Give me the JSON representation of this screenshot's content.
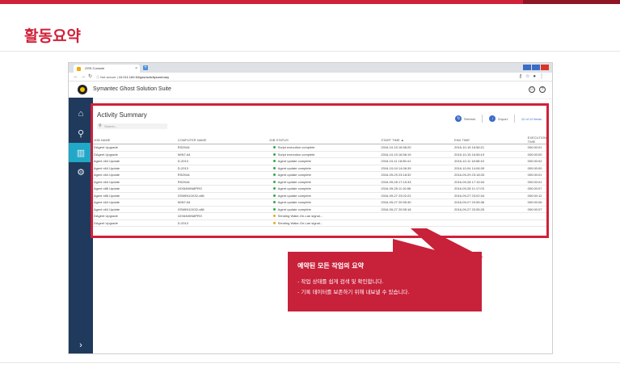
{
  "slide": {
    "title": "활동요약"
  },
  "browser": {
    "tab_title": "GSS Console",
    "tab_close": "×",
    "new_tab": "+",
    "url_prefix": "Not secure",
    "url": "10.211.169.54/gss/activitysummary"
  },
  "app": {
    "name": "Symantec Ghost Solution Suite"
  },
  "panel": {
    "title": "Activity Summary",
    "search_placeholder": "Search...",
    "refresh_label": "Refresh",
    "export_label": "Export",
    "count_text": "12 of 12 items"
  },
  "table": {
    "headers": [
      "JOB NAME",
      "COMPUTER NAME",
      "JOB STATUS",
      "START TIME ▲",
      "END TIME",
      "EXECUTION TIME"
    ],
    "rows": [
      [
        "DAgent Upgrade",
        "RS2K64",
        "Script execution complete",
        "ok",
        "2016-10-15 16:56:20",
        "2016-10-15 16:56:21",
        "000:00:01"
      ],
      [
        "DAgent Upgrade",
        "WIN7-64",
        "Script execution complete",
        "ok",
        "2016-10-15 16:56:19",
        "2016-10-15 16:56:19",
        "000:00:00"
      ],
      [
        "Agent x64 Update",
        "D-2013",
        "Agent update complete",
        "ok",
        "2016-10-11 18:55:41",
        "2016-10-11 18:55:43",
        "000:00:02"
      ],
      [
        "Agent x64 Update",
        "D-2013",
        "Agent update complete",
        "ok",
        "2016-10-04 14:06:39",
        "2016-10-04 14:06:39",
        "000:00:00"
      ],
      [
        "Agent x64 Update",
        "RS2K64",
        "Agent update complete",
        "ok",
        "2016-09-29 23:18:32",
        "2016-09-29 23:18:33",
        "000:00:01"
      ],
      [
        "Agent x64 Update",
        "RS2K64",
        "Agent update complete",
        "ok",
        "2016-09-28 17:15:33",
        "2016-09-28 17:15:34",
        "000:00:01"
      ],
      [
        "Agent x86 Update",
        "10X64WIN8PRO",
        "Agent update complete",
        "ok",
        "2016-09-28 11:16:56",
        "2016-09-28 11:17:03",
        "000:00:07"
      ],
      [
        "Agent x86 Update",
        "GSWIN10X32-x86",
        "Agent update complete",
        "ok",
        "2016-09-27 23:02:22",
        "2016-09-27 23:02:34",
        "000:00:12"
      ],
      [
        "Agent x64 Update",
        "WIN7-64",
        "Agent update complete",
        "ok",
        "2016-09-27 20:55:30",
        "2016-09-27 20:55:36",
        "000:00:06"
      ],
      [
        "Agent x64 Update",
        "GSWIN10X32-x86",
        "Agent update complete",
        "ok",
        "2016-09-27 20:55:18",
        "2016-09-27 20:55:25",
        "000:00:07"
      ],
      [
        "DAgent Upgrade",
        "10X64WIN8PRO",
        "Sending Wake-On-Lan signal...",
        "warn",
        "",
        "",
        ""
      ],
      [
        "DAgent Upgrade",
        "D-2013",
        "Sending Wake-On-Lan signal...",
        "warn",
        "",
        "",
        ""
      ]
    ]
  },
  "callout": {
    "title": "예약된 모든 작업의 요약",
    "lines": [
      "- 작업 상태를 쉽게 검색 및 확인합니다.",
      "- 기록 데이터를 보존하기 위해 내보낼 수 있습니다."
    ]
  },
  "colors": {
    "accent": "#d0213a",
    "sidebar": "#1f3a5c",
    "active": "#21a8c8"
  },
  "icons": {
    "sidebar": [
      "home-icon",
      "network-icon",
      "chart-icon",
      "gear-icon"
    ],
    "expand": "chevron-right-icon",
    "header": [
      "user-icon",
      "help-icon"
    ]
  }
}
